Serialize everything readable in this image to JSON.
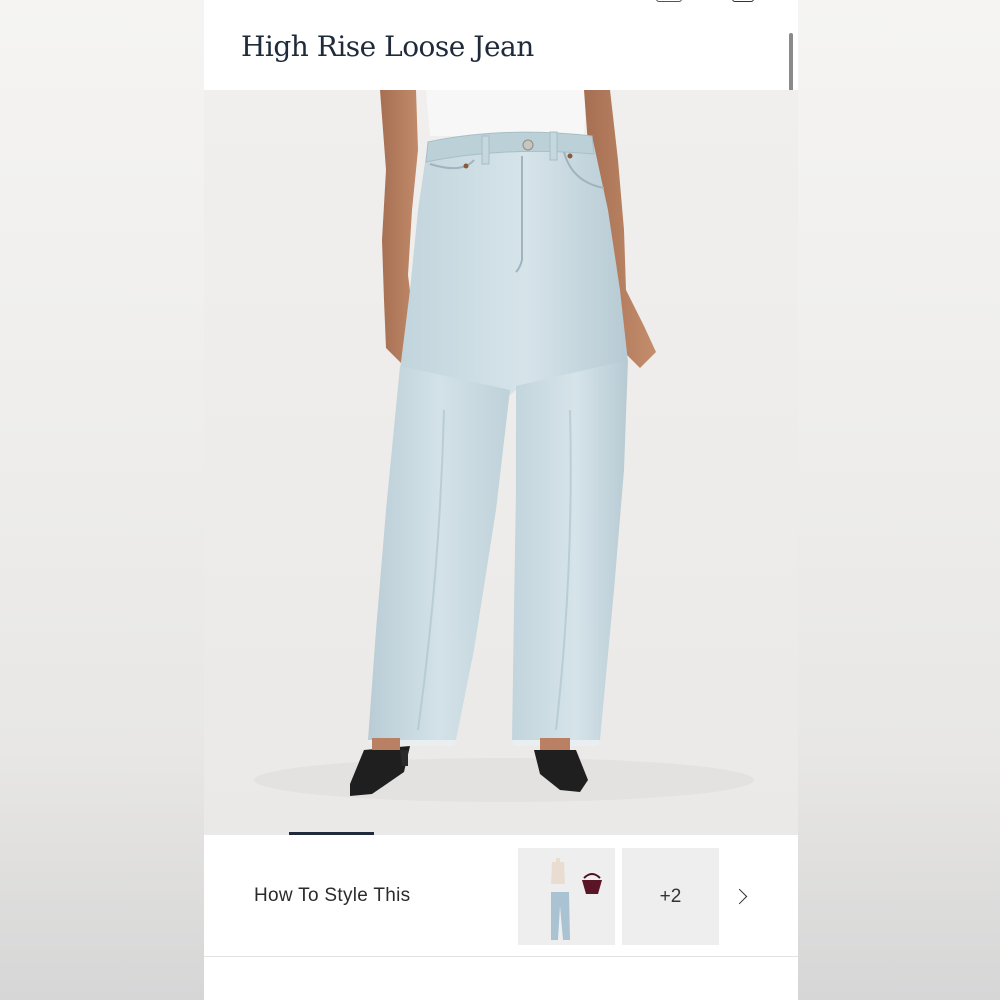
{
  "product": {
    "title": "High Rise Loose Jean"
  },
  "style_section": {
    "label": "How To Style This",
    "more_count": "+2"
  },
  "carousel": {
    "active_index": 1
  },
  "icons": {
    "top_left": "account-icon",
    "top_right": "bag-icon",
    "chevron": "chevron-right-icon"
  },
  "colors": {
    "title": "#1f2b3a",
    "indicator": "#1f2b3a",
    "denim": "#c9dbe2"
  }
}
